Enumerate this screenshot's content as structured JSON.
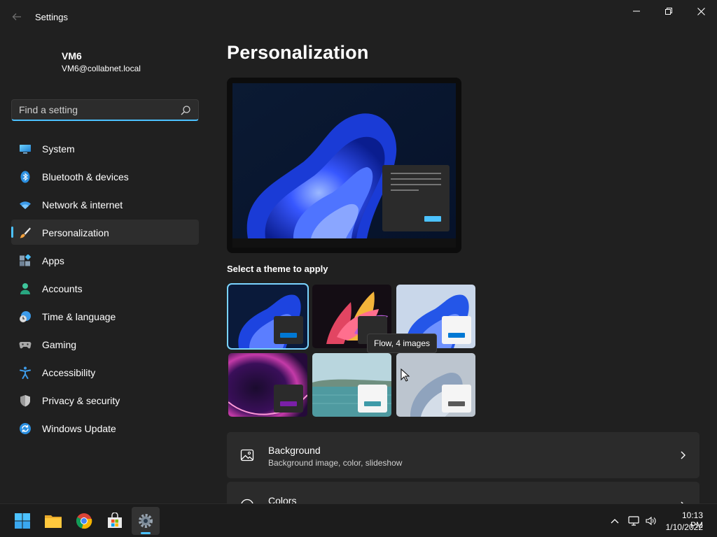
{
  "window": {
    "title": "Settings"
  },
  "user": {
    "name": "VM6",
    "email": "VM6@collabnet.local"
  },
  "search": {
    "placeholder": "Find a setting",
    "value": ""
  },
  "sidebar": {
    "items": [
      {
        "label": "System",
        "icon": "display-icon",
        "active": false
      },
      {
        "label": "Bluetooth & devices",
        "icon": "bluetooth-icon",
        "active": false
      },
      {
        "label": "Network & internet",
        "icon": "wifi-icon",
        "active": false
      },
      {
        "label": "Personalization",
        "icon": "brush-icon",
        "active": true
      },
      {
        "label": "Apps",
        "icon": "apps-icon",
        "active": false
      },
      {
        "label": "Accounts",
        "icon": "person-icon",
        "active": false
      },
      {
        "label": "Time & language",
        "icon": "clock-globe-icon",
        "active": false
      },
      {
        "label": "Gaming",
        "icon": "gamepad-icon",
        "active": false
      },
      {
        "label": "Accessibility",
        "icon": "accessibility-icon",
        "active": false
      },
      {
        "label": "Privacy & security",
        "icon": "shield-icon",
        "active": false
      },
      {
        "label": "Windows Update",
        "icon": "update-icon",
        "active": false
      }
    ]
  },
  "main": {
    "title": "Personalization",
    "themes_label": "Select a theme to apply",
    "tooltip": "Flow, 4 images",
    "cards": [
      {
        "title": "Background",
        "subtitle": "Background image, color, slideshow",
        "icon": "image-icon"
      },
      {
        "title": "Colors",
        "subtitle": "",
        "icon": "palette-icon"
      }
    ]
  },
  "taskbar": {
    "apps": [
      "start-icon",
      "file-explorer-icon",
      "chrome-icon",
      "store-icon",
      "settings-icon"
    ],
    "time": "10:13 PM",
    "date": "1/10/2022"
  },
  "colors": {
    "accent": "#4cc2ff",
    "background": "#202020",
    "card": "#2b2b2b"
  }
}
